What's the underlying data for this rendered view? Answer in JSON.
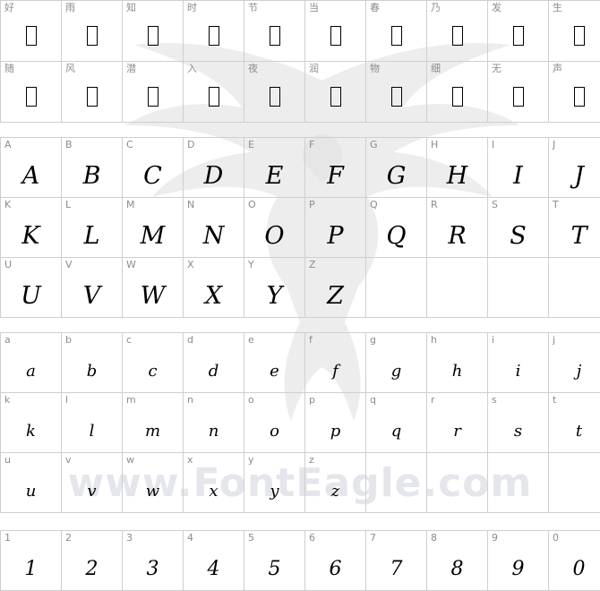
{
  "watermark": {
    "text": "www.FontEagle.com"
  },
  "sections": [
    {
      "id": "cjk",
      "glyph_style": "missing-glyph-box",
      "rows": [
        [
          "好",
          "雨",
          "知",
          "时",
          "节",
          "当",
          "春",
          "乃",
          "发",
          "生"
        ],
        [
          "随",
          "风",
          "潜",
          "入",
          "夜",
          "润",
          "物",
          "细",
          "无",
          "声"
        ]
      ]
    },
    {
      "id": "uppercase",
      "glyph_style": "handwritten",
      "rows": [
        [
          "A",
          "B",
          "C",
          "D",
          "E",
          "F",
          "G",
          "H",
          "I",
          "J"
        ],
        [
          "K",
          "L",
          "M",
          "N",
          "O",
          "P",
          "Q",
          "R",
          "S",
          "T"
        ],
        [
          "U",
          "V",
          "W",
          "X",
          "Y",
          "Z",
          "",
          "",
          "",
          ""
        ]
      ]
    },
    {
      "id": "lowercase",
      "glyph_style": "handwritten",
      "rows": [
        [
          "a",
          "b",
          "c",
          "d",
          "e",
          "f",
          "g",
          "h",
          "i",
          "j"
        ],
        [
          "k",
          "l",
          "m",
          "n",
          "o",
          "p",
          "q",
          "r",
          "s",
          "t"
        ],
        [
          "u",
          "v",
          "w",
          "x",
          "y",
          "z",
          "",
          "",
          "",
          ""
        ]
      ]
    },
    {
      "id": "digits",
      "glyph_style": "handwritten",
      "rows": [
        [
          "1",
          "2",
          "3",
          "4",
          "5",
          "6",
          "7",
          "8",
          "9",
          "0"
        ]
      ]
    }
  ]
}
